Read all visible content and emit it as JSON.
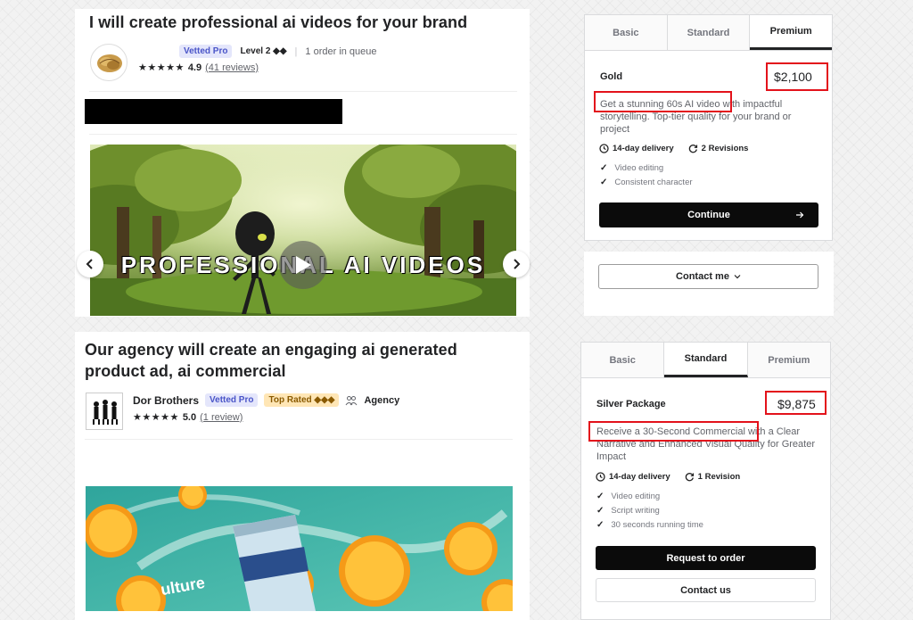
{
  "gig1": {
    "title": "I will create professional ai videos for your brand",
    "badge_vetted": "Vetted Pro",
    "level": "Level 2 ◆◆",
    "queue": "1 order in queue",
    "stars": "★★★★★",
    "rating": "4.9",
    "reviews": "(41 reviews)",
    "video_caption": "PROFESSIONAL AI VIDEOS",
    "package": {
      "tabs": [
        "Basic",
        "Standard",
        "Premium"
      ],
      "active_tab": "Premium",
      "name": "Gold",
      "price": "$2,100",
      "description": "Get a stunning 60s AI video with impactful storytelling. Top-tier quality for your brand or project",
      "delivery": "14-day delivery",
      "revisions": "2 Revisions",
      "features": [
        "Video editing",
        "Consistent character"
      ],
      "continue_label": "Continue",
      "contact_label": "Contact me"
    }
  },
  "gig2": {
    "title": "Our agency will create an engaging ai generated product ad, ai commercial",
    "seller_name": "Dor Brothers",
    "badge_vetted": "Vetted Pro",
    "badge_top": "Top Rated ◆◆◆",
    "agency_label": "Agency",
    "stars": "★★★★★",
    "rating": "5.0",
    "reviews": "(1 review)",
    "can_text": "ulture",
    "package": {
      "tabs": [
        "Basic",
        "Standard",
        "Premium"
      ],
      "active_tab": "Standard",
      "name": "Silver Package",
      "price": "$9,875",
      "description": "Receive a 30-Second Commercial with a Clear Narrative and Enhanced Visual Quality for Greater Impact",
      "delivery": "14-day delivery",
      "revisions": "1 Revision",
      "features": [
        "Video editing",
        "Script writing",
        "30 seconds running time"
      ],
      "order_label": "Request to order",
      "contact_label": "Contact us"
    }
  },
  "colors": {
    "highlight": "#e3121b",
    "dark_button": "#0b0b0b",
    "vetted_bg": "#e4e6fb",
    "top_rated_bg": "#ffe6b5"
  }
}
